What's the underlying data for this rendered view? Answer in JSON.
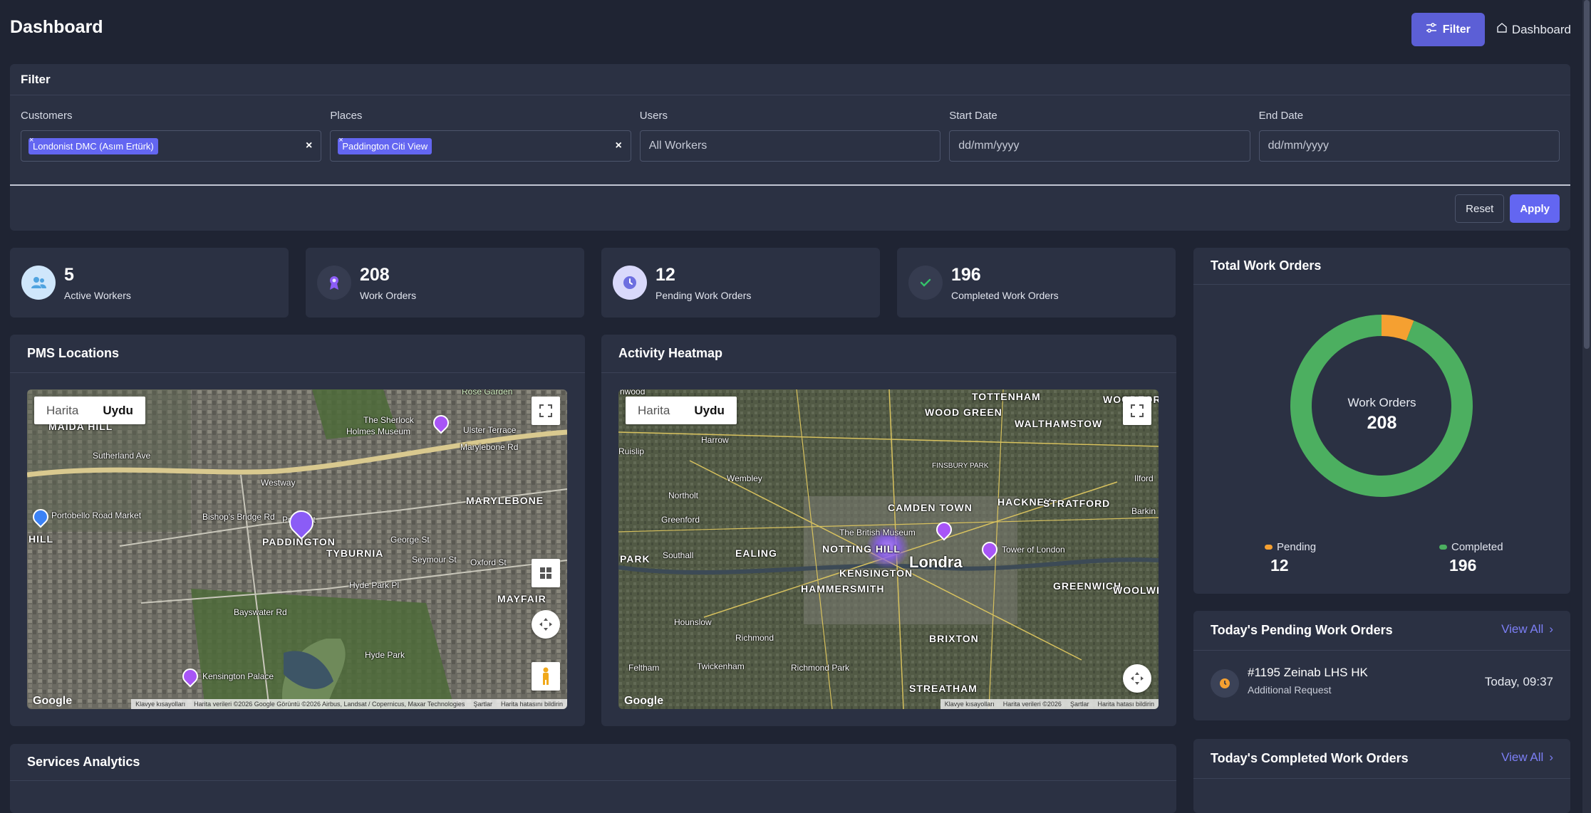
{
  "header": {
    "title": "Dashboard",
    "filter_label": "Filter",
    "dashboard_label": "Dashboard"
  },
  "filter": {
    "title": "Filter",
    "fields": [
      {
        "label": "Customers",
        "chip": "Londonist DMC (Asım Ertürk)",
        "clear": "×"
      },
      {
        "label": "Places",
        "chip": "Paddington Citi View",
        "clear": "×"
      },
      {
        "label": "Users",
        "value": "All Workers"
      },
      {
        "label": "Start Date",
        "placeholder": "dd/mm/yyyy"
      },
      {
        "label": "End Date",
        "placeholder": "dd/mm/yyyy"
      }
    ],
    "chip_remove": "×",
    "reset_label": "Reset",
    "apply_label": "Apply"
  },
  "stats": [
    {
      "value": "5",
      "label": "Active Workers",
      "icon": "users-icon",
      "color": "#4fa3e0"
    },
    {
      "value": "208",
      "label": "Work Orders",
      "icon": "award-icon",
      "color": "#8b5cf6"
    },
    {
      "value": "12",
      "label": "Pending Work Orders",
      "icon": "clock-icon",
      "color": "#6d6fe0"
    },
    {
      "value": "196",
      "label": "Completed Work Orders",
      "icon": "check-icon",
      "color": "#34c26a"
    }
  ],
  "pms_map": {
    "title": "PMS Locations",
    "map_type": [
      "Harita",
      "Uydu"
    ],
    "labels": [
      "Rose Garden",
      "The Sherlock",
      "Holmes Museum",
      "Ulster Terrace",
      "Marylebone Rd",
      "MAIDA HILL",
      "Westway",
      "Portobello Road Market",
      "MARYLEBONE",
      "PADDINGTON",
      "TYBURNIA",
      "HILL",
      "Bishop's Bridge Rd",
      "Oxford St",
      "Hyde Park Pl",
      "MAYFAIR",
      "Bayswater Rd",
      "Hyde Park",
      "Kensington Palace",
      "George St",
      "Seymour St",
      "Sutherland Ave",
      "Praed St"
    ],
    "google": "Google",
    "attribution": [
      "Klavye kısayolları",
      "Harita verileri ©2026 Google Görüntü ©2026 Airbus, Landsat / Copernicus, Maxar Technologies",
      "Şartlar",
      "Harita hatasını bildirin"
    ]
  },
  "heat_map": {
    "title": "Activity Heatmap",
    "map_type": [
      "Harita",
      "Uydu"
    ],
    "labels": [
      "TOTTENHAM",
      "WOODFOR",
      "WOOD GREEN",
      "WALTHAMSTOW",
      "Harrow",
      "FINSBURY PARK",
      "Wembley",
      "Ilford",
      "CAMDEN TOWN",
      "HACKNEY",
      "STRATFORD",
      "Northolt",
      "Barkin",
      "Greenford",
      "The British Museum",
      "EALING",
      "NOTTING HILL",
      "Tower of London",
      "Southall",
      "Londra",
      "KENSINGTON",
      "HAMMERSMITH",
      "GREENWICH",
      "WOOLWIC",
      "Hounslow",
      "Richmond",
      "BRIXTON",
      "Feltham",
      "Twickenham",
      "Richmond Park",
      "STREATHAM",
      "Ruislip",
      "PARK",
      "nwood"
    ],
    "google": "Google",
    "attribution": [
      "Klavye kısayolları",
      "Harita verileri ©2026",
      "Şartlar",
      "Harita hatası bildirin"
    ]
  },
  "total_work_orders": {
    "title": "Total Work Orders",
    "center_label": "Work Orders",
    "center_value": "208",
    "legend": [
      {
        "name": "Pending",
        "value": "12",
        "color": "#f5a031"
      },
      {
        "name": "Completed",
        "value": "196",
        "color": "#4caf60"
      }
    ]
  },
  "chart_data": {
    "type": "pie",
    "categories": [
      "Pending",
      "Completed"
    ],
    "values": [
      12,
      196
    ],
    "colors": [
      "#f5a031",
      "#4caf60"
    ],
    "title": "Total Work Orders",
    "legend": "bottom"
  },
  "pending_orders": {
    "title": "Today's Pending Work Orders",
    "view_all": "View All",
    "items": [
      {
        "title": "#1195 Zeinab LHS HK",
        "subtitle": "Additional Request",
        "time": "Today, 09:37"
      }
    ]
  },
  "completed_orders": {
    "title": "Today's Completed Work Orders",
    "view_all": "View All"
  },
  "services": {
    "title": "Services Analytics"
  }
}
